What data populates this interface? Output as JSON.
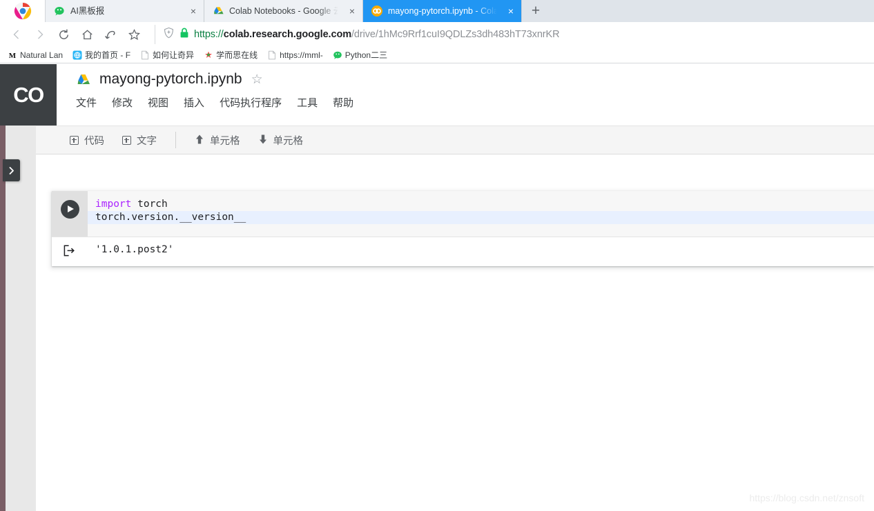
{
  "browser": {
    "tabs": [
      {
        "title": "AI黑板报",
        "icon": "wechat-icon",
        "active": false,
        "close_label": "×"
      },
      {
        "title": "Colab Notebooks - Google 云",
        "icon": "google-drive-icon",
        "active": false,
        "close_label": "×"
      },
      {
        "title": "mayong-pytorch.ipynb - Colab",
        "icon": "colab-icon",
        "active": true,
        "close_label": "×"
      }
    ],
    "new_tab_label": "+",
    "nav": {
      "back": "‹",
      "forward": "›",
      "reload": "⟳",
      "home": "⌂",
      "history": "↶",
      "bookmark_star": "☆"
    },
    "address": {
      "shield_icon": "shield-plus-icon",
      "lock_icon": "lock-icon",
      "scheme": "https://",
      "host": "colab.research.google.com",
      "path": "/drive/1hMc9Rrf1cuI9QDLZs3dh483hT73xnrKR",
      "full_url": "https://colab.research.google.com/drive/1hMc9Rrf1cuI9QDLZs3dh483hT73xnrKR"
    },
    "bookmarks": [
      {
        "label": "Natural Lan",
        "icon": "m-letter-icon"
      },
      {
        "label": "我的首页 - F",
        "icon": "blue-globe-icon"
      },
      {
        "label": "如何让奇异",
        "icon": "page-icon"
      },
      {
        "label": "学而思在线",
        "icon": "xueersi-icon"
      },
      {
        "label": "https://mml-",
        "icon": "page-icon"
      },
      {
        "label": "Python二三",
        "icon": "wechat-icon"
      }
    ]
  },
  "colab": {
    "logo_text": "CO",
    "drive_icon": "google-drive-icon",
    "filename": "mayong-pytorch.ipynb",
    "star_icon": "☆",
    "menu": [
      "文件",
      "修改",
      "视图",
      "插入",
      "代码执行程序",
      "工具",
      "帮助"
    ],
    "toolbar": {
      "add_code_label": "代码",
      "add_text_label": "文字",
      "move_up_label": "单元格",
      "move_down_label": "单元格",
      "up_arrow": "⬆",
      "down_arrow": "⬇"
    },
    "drawer_toggle_icon": "›",
    "cell": {
      "code_lines": [
        {
          "segments": [
            {
              "text": "import",
              "kind": "keyword"
            },
            {
              "text": " torch",
              "kind": "plain"
            }
          ],
          "highlighted": false
        },
        {
          "segments": [
            {
              "text": "torch.version.__version__",
              "kind": "plain"
            }
          ],
          "highlighted": true
        }
      ],
      "output": "'1.0.1.post2'",
      "run_button_label": "run-cell",
      "output_icon": "output-arrow-icon"
    }
  },
  "watermark": "https://blog.csdn.net/znsoft"
}
